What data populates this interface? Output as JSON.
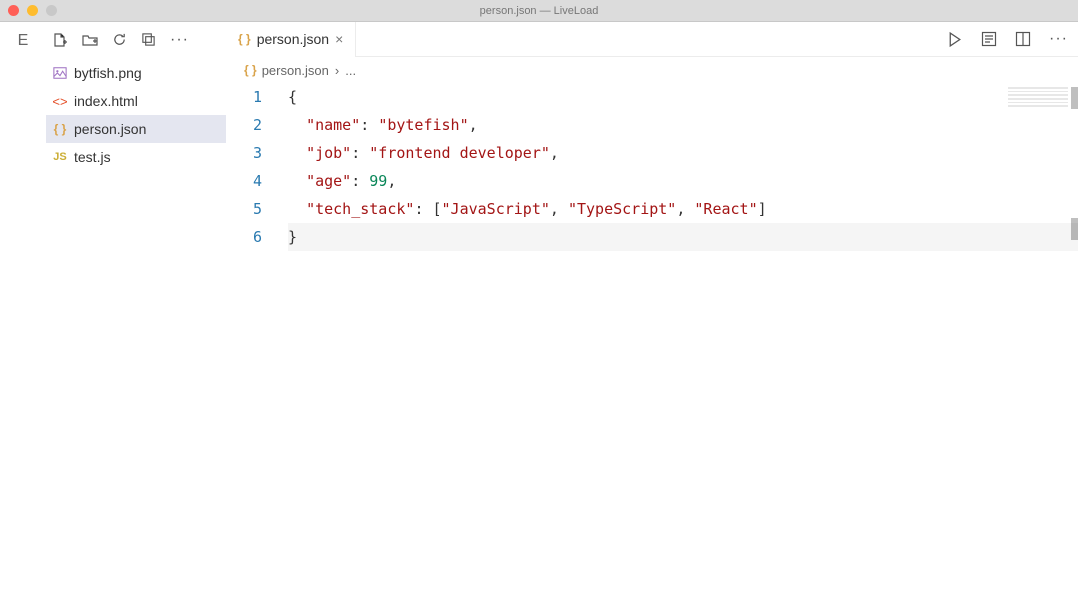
{
  "window": {
    "title": "person.json — LiveLoad"
  },
  "activity": {
    "label": "E"
  },
  "sidebar": {
    "files": [
      {
        "name": "bytfish.png",
        "icon": "image"
      },
      {
        "name": "index.html",
        "icon": "html"
      },
      {
        "name": "person.json",
        "icon": "json",
        "active": true
      },
      {
        "name": "test.js",
        "icon": "js"
      }
    ]
  },
  "tabs": [
    {
      "label": "person.json",
      "icon": "json"
    }
  ],
  "breadcrumbs": [
    {
      "label": "person.json",
      "icon": "json"
    },
    {
      "label": "..."
    }
  ],
  "code": {
    "line_numbers": [
      "1",
      "2",
      "3",
      "4",
      "5",
      "6"
    ],
    "json_content": {
      "name": "bytefish",
      "job": "frontend developer",
      "age": 99,
      "tech_stack": [
        "JavaScript",
        "TypeScript",
        "React"
      ]
    },
    "current_line": 6,
    "tokens": {
      "l1": {
        "brace": "{"
      },
      "l2": {
        "key": "\"name\"",
        "colon": ": ",
        "val": "\"bytefish\"",
        "comma": ","
      },
      "l3": {
        "key": "\"job\"",
        "colon": ": ",
        "val": "\"frontend developer\"",
        "comma": ","
      },
      "l4": {
        "key": "\"age\"",
        "colon": ": ",
        "val": "99",
        "comma": ","
      },
      "l5": {
        "key": "\"tech_stack\"",
        "colon": ": ",
        "lb": "[",
        "v1": "\"JavaScript\"",
        "c1": ", ",
        "v2": "\"TypeScript\"",
        "c2": ", ",
        "v3": "\"React\"",
        "rb": "]"
      },
      "l6": {
        "brace": "}"
      }
    }
  },
  "icons": {
    "ellipsis": "···",
    "close_tab": "×"
  }
}
